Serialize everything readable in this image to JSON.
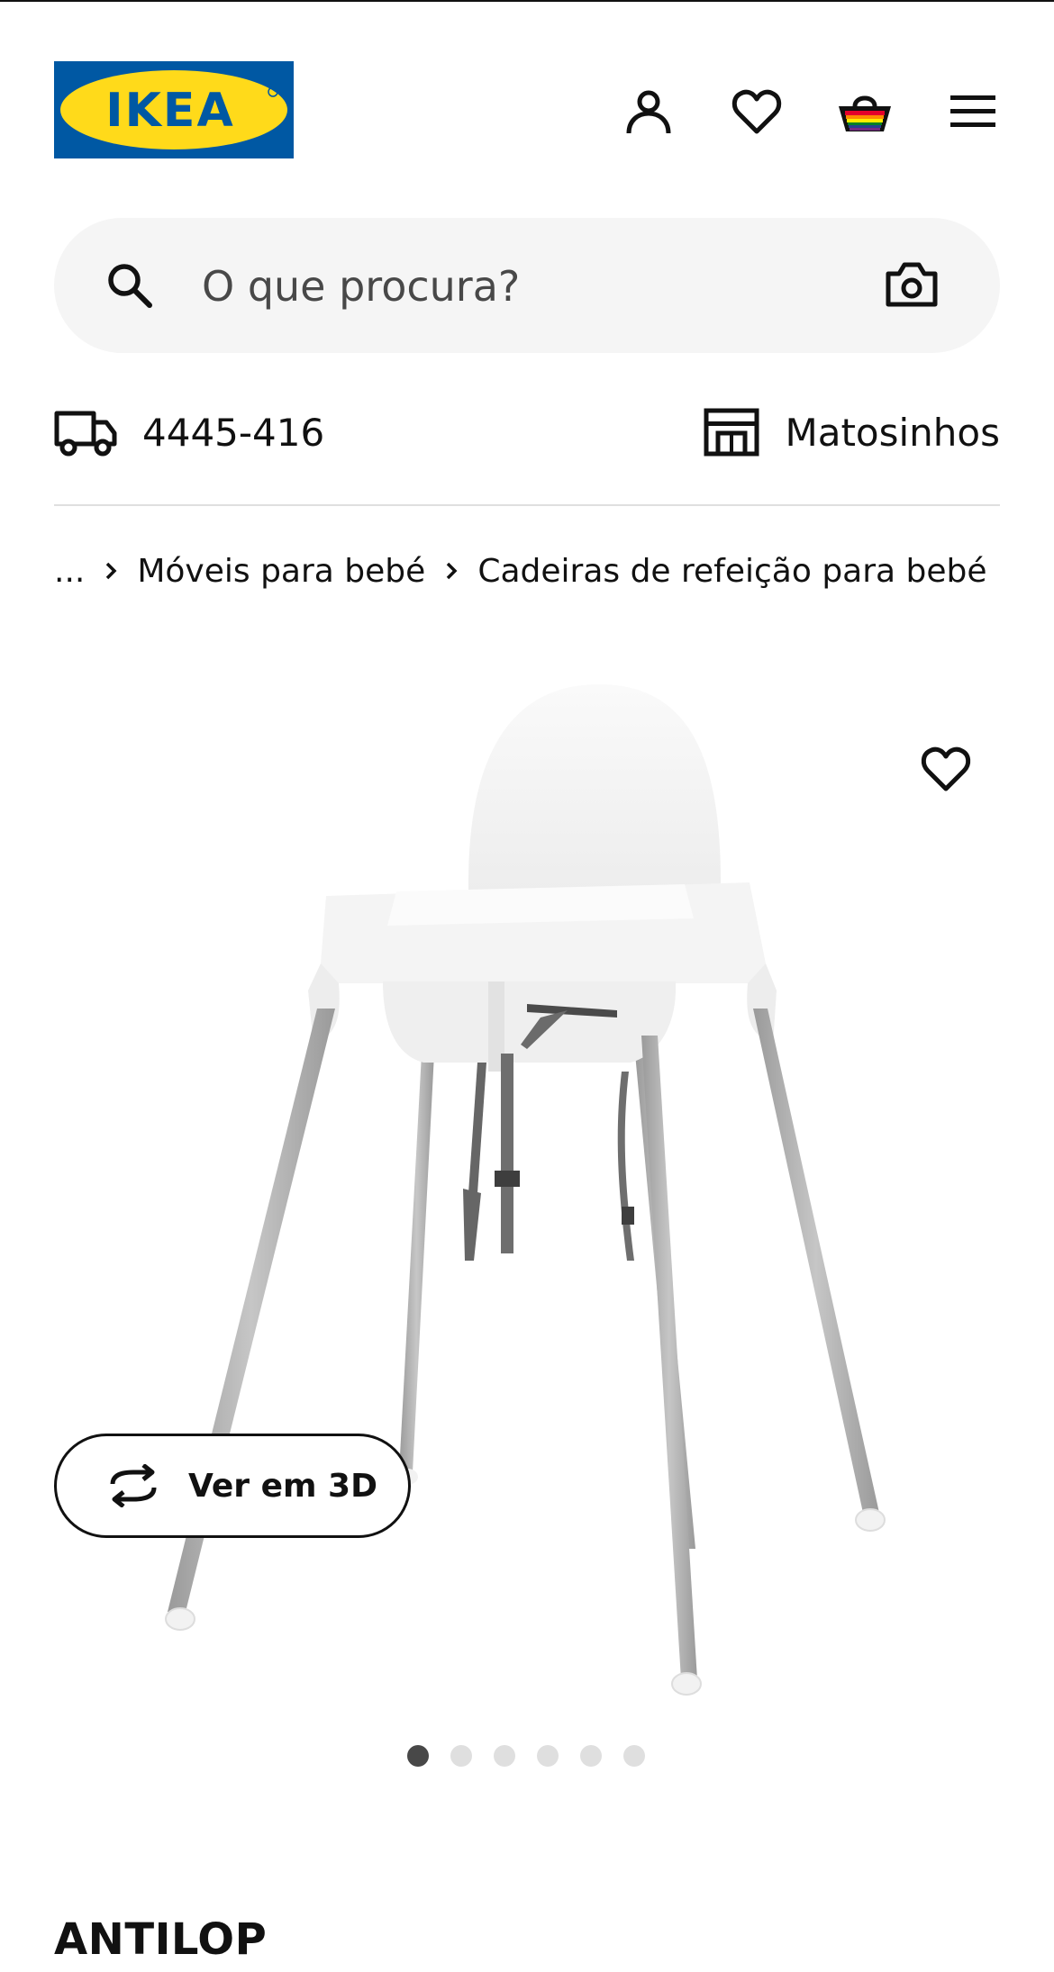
{
  "header": {
    "logo_text": "IKEA",
    "brand_colors": {
      "blue": "#0058A3",
      "yellow": "#FFDA1A"
    },
    "icons": [
      "profile-icon",
      "heart-icon",
      "basket-icon",
      "menu-icon"
    ]
  },
  "search": {
    "placeholder": "O que procura?",
    "icons": [
      "search-icon",
      "camera-icon"
    ]
  },
  "location": {
    "postal_code": "4445-416",
    "store": "Matosinhos",
    "icons": [
      "truck-icon",
      "store-icon"
    ]
  },
  "breadcrumb": {
    "items": [
      "...",
      "Móveis para bebé",
      "Cadeiras de refeição para bebé"
    ]
  },
  "gallery": {
    "view_3d_label": "Ver em 3D",
    "image_count": 6,
    "active_index": 0
  },
  "product": {
    "name": "ANTILOP"
  }
}
